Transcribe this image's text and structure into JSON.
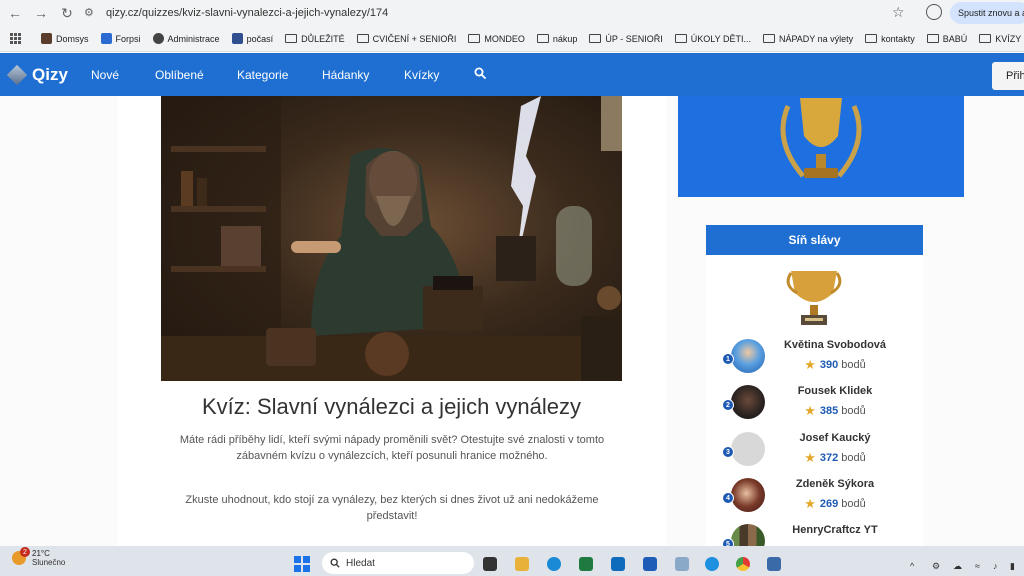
{
  "browser": {
    "url": "qizy.cz/quizzes/kviz-slavni-vynalezci-a-jejich-vynalezy/174",
    "relaunch_label": "Spustit znovu a a"
  },
  "bookmarks": [
    {
      "label": "Domsys",
      "type": "site",
      "color": "#5a3e2b"
    },
    {
      "label": "Forpsi",
      "type": "site",
      "color": "#2a6ad1"
    },
    {
      "label": "Administrace",
      "type": "site",
      "color": "#444444"
    },
    {
      "label": "počasí",
      "type": "site",
      "color": "#2f4f8f"
    },
    {
      "label": "DŮLEŽITÉ",
      "type": "folder"
    },
    {
      "label": "CVIČENÍ + SENIOŘI",
      "type": "folder"
    },
    {
      "label": "MONDEO",
      "type": "folder"
    },
    {
      "label": "nákup",
      "type": "folder"
    },
    {
      "label": "ÚP - SENIOŘI",
      "type": "folder"
    },
    {
      "label": "ÚKOLY DĚTI...",
      "type": "folder"
    },
    {
      "label": "NÁPADY na výlety",
      "type": "folder"
    },
    {
      "label": "kontakty",
      "type": "folder"
    },
    {
      "label": "BABÚ",
      "type": "folder"
    },
    {
      "label": "KVÍZY",
      "type": "folder"
    }
  ],
  "site": {
    "logo": "Qizy",
    "nav": [
      "Nové",
      "Oblíbené",
      "Kategorie",
      "Hádanky",
      "Kvízky"
    ],
    "login_label": "Přih"
  },
  "quiz": {
    "title": "Kvíz: Slavní vynálezci a jejich vynálezy",
    "description": "Máte rádi příběhy lidí, kteří svými nápady proměnili svět? Otestujte své znalosti v tomto zábavném kvízu o vynálezcích, kteří posunuli hranice možného.",
    "prompt": "Zkuste uhodnout, kdo stojí za vynálezy, bez kterých si dnes život už ani nedokážeme představit!"
  },
  "hall_of_fame": {
    "title": "Síň slávy",
    "points_unit": "bodů",
    "entries": [
      {
        "rank": "1",
        "name": "Květina Svobodová",
        "points": "390"
      },
      {
        "rank": "2",
        "name": "Fousek Klidek",
        "points": "385"
      },
      {
        "rank": "3",
        "name": "Josef Kaucký",
        "points": "372"
      },
      {
        "rank": "4",
        "name": "Zdeněk Sýkora",
        "points": "269"
      },
      {
        "rank": "5",
        "name": "HenryCraftcz YT",
        "points": ""
      }
    ]
  },
  "taskbar": {
    "weather_temp": "21°C",
    "weather_cond": "Slunečno",
    "weather_badge": "2",
    "search_placeholder": "Hledat"
  },
  "colors": {
    "brand_blue": "#1e6fd1",
    "star_gold": "#e3a82a"
  }
}
